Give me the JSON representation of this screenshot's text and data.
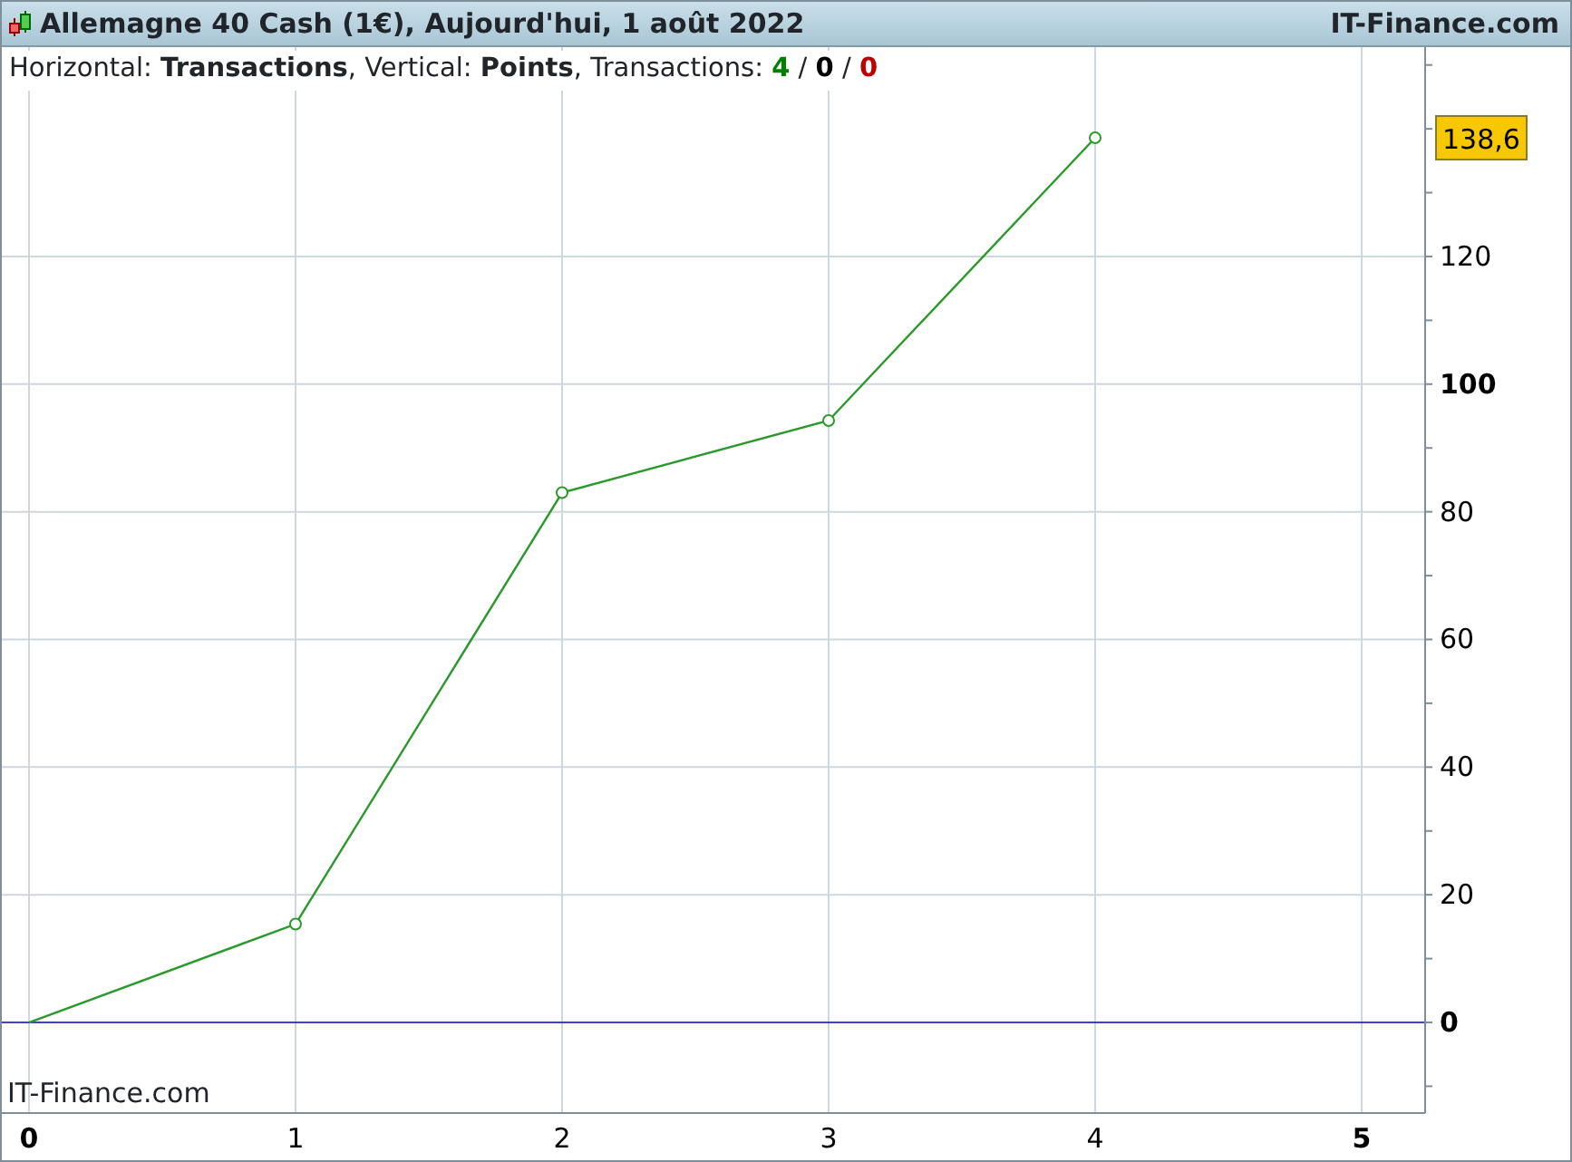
{
  "window": {
    "title": "Allemagne 40 Cash (1€), Aujourd'hui, 1 août 2022",
    "brand": "IT-Finance.com"
  },
  "legend": {
    "text": "Horizontal: **Transactions**, Vertical: **Points**, Transactions: ",
    "counts": [
      {
        "value": "4",
        "color": "#008000"
      },
      {
        "value": "0",
        "color": "#000000"
      },
      {
        "value": "0",
        "color": "#c00000"
      }
    ],
    "separator": "/"
  },
  "chart": {
    "watermark": "IT-Finance.com",
    "last_value": "138,6",
    "chart_data": {
      "type": "line",
      "x": [
        0,
        1,
        2,
        3,
        4
      ],
      "series": [
        {
          "color": "#2a9a2a",
          "marker": "o",
          "values": [
            0,
            15.4,
            83,
            94.3,
            138.6
          ]
        }
      ],
      "grid": true,
      "ref_lines": [
        {
          "axis": "y",
          "value": 0,
          "color": "#4040d8"
        }
      ],
      "xlim": [
        -0.102,
        5.238
      ],
      "ylim": [
        -14.2,
        152.8
      ],
      "xticks": [
        0,
        1,
        2,
        3,
        4,
        5
      ],
      "yticks": [
        0,
        20,
        40,
        60,
        80,
        100,
        120
      ]
    }
  }
}
